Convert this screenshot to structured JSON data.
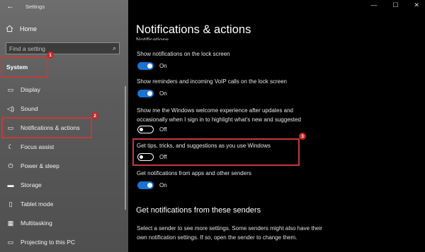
{
  "window": {
    "title": "Settings",
    "back_icon": "←",
    "minimize_icon": "—",
    "maximize_icon": "☐",
    "close_icon": "✕"
  },
  "sidebar": {
    "home_label": "Home",
    "search_placeholder": "Find a setting",
    "search_icon": "⌕",
    "system_label": "System",
    "items": [
      {
        "label": "Display",
        "icon": "▭"
      },
      {
        "label": "Sound",
        "icon": "◁)"
      },
      {
        "label": "Notifications & actions",
        "icon": "▭"
      },
      {
        "label": "Focus assist",
        "icon": "☾"
      },
      {
        "label": "Power & sleep",
        "icon": "⏻"
      },
      {
        "label": "Storage",
        "icon": "▬"
      },
      {
        "label": "Tablet mode",
        "icon": "▯"
      },
      {
        "label": "Multitasking",
        "icon": "▦"
      },
      {
        "label": "Projecting to this PC",
        "icon": "▭"
      }
    ]
  },
  "annotations": {
    "badge1": "1",
    "badge2": "2",
    "badge3": "3",
    "highlight_color": "#c23b3b"
  },
  "main": {
    "title": "Notifications & actions",
    "section_heading": "Notifications",
    "settings": [
      {
        "label": "Show notifications on the lock screen",
        "state": "On"
      },
      {
        "label": "Show reminders and incoming VoIP calls on the lock screen",
        "state": "On"
      },
      {
        "label": "Show me the Windows welcome experience after updates and occasionally when I sign in to highlight what's new and suggested",
        "state": "Off"
      },
      {
        "label": "Get tips, tricks, and suggestions as you use Windows",
        "state": "Off"
      },
      {
        "label": "Get notifications from apps and other senders",
        "state": "On"
      }
    ],
    "senders_heading": "Get notifications from these senders",
    "senders_text": "Select a sender to see more settings. Some senders might also have their own notification settings. If so, open the sender to change them."
  },
  "colors": {
    "toggle_on": "#1a73d0",
    "sidebar_bg": "#5b5b5b",
    "main_bg": "#000000"
  }
}
